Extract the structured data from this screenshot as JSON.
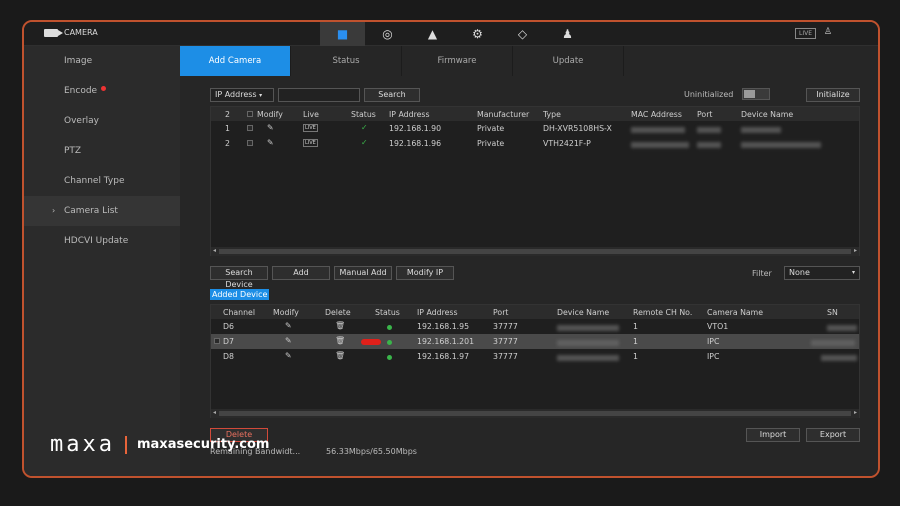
{
  "header": {
    "title": "CAMERA",
    "live_label": "LIVE"
  },
  "sidebar": {
    "items": [
      {
        "label": "Image"
      },
      {
        "label": "Encode"
      },
      {
        "label": "Overlay"
      },
      {
        "label": "PTZ"
      },
      {
        "label": "Channel Type"
      },
      {
        "label": "Camera List"
      },
      {
        "label": "HDCVI Update"
      }
    ]
  },
  "tabs": [
    {
      "label": "Add Camera"
    },
    {
      "label": "Status"
    },
    {
      "label": "Firmware"
    },
    {
      "label": "Update"
    }
  ],
  "search_bar": {
    "mode": "IP Address",
    "search_label": "Search",
    "uninitialized_label": "Uninitialized",
    "initialize_label": "Initialize"
  },
  "found_table": {
    "count": "2",
    "headers": [
      "Modify",
      "Live",
      "Status",
      "IP Address",
      "Manufacturer",
      "Type",
      "MAC Address",
      "Port",
      "Device Name"
    ],
    "rows": [
      {
        "idx": "1",
        "ip": "192.168.1.90",
        "manufacturer": "Private",
        "type": "DH-XVR5108HS-X"
      },
      {
        "idx": "2",
        "ip": "192.168.1.96",
        "manufacturer": "Private",
        "type": "VTH2421F-P"
      }
    ]
  },
  "actions": {
    "search_device": "Search Device",
    "add": "Add",
    "manual_add": "Manual Add",
    "modify_ip": "Modify IP",
    "filter_label": "Filter",
    "filter_value": "None"
  },
  "added": {
    "tag": "Added Device",
    "headers": [
      "Channel",
      "Modify",
      "Delete",
      "Status",
      "IP Address",
      "Port",
      "Device Name",
      "Remote CH No.",
      "Camera Name",
      "SN"
    ],
    "rows": [
      {
        "channel": "D6",
        "ip": "192.168.1.95",
        "port": "37777",
        "remote": "1",
        "camera": "VTO1"
      },
      {
        "channel": "D7",
        "ip": "192.168.1.201",
        "port": "37777",
        "remote": "1",
        "camera": "IPC"
      },
      {
        "channel": "D8",
        "ip": "192.168.1.97",
        "port": "37777",
        "remote": "1",
        "camera": "IPC"
      }
    ]
  },
  "bottom": {
    "delete_label": "Delete",
    "import_label": "Import",
    "export_label": "Export",
    "bandwidth_label": "Remaining Bandwidt...",
    "bandwidth_value": "56.33Mbps/65.50Mbps"
  },
  "branding": {
    "brand": "maxa",
    "site": "maxasecurity.com"
  },
  "colors": {
    "accent": "#1d8ee6",
    "frame": "#c0522e",
    "status_ok": "#3ab54a",
    "alert": "#e0201a"
  }
}
